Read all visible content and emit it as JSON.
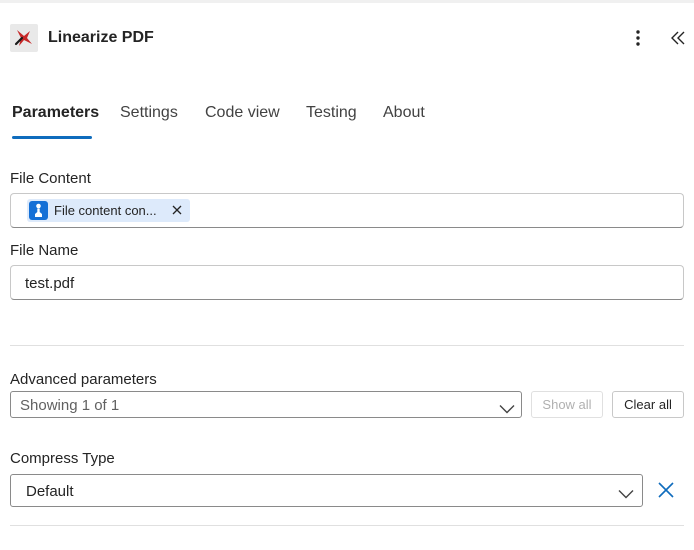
{
  "header": {
    "title": "Linearize PDF",
    "icon": "linearize-pdf-app-icon",
    "more_icon": "more-vertical-icon",
    "collapse_icon": "double-chevron-left-icon"
  },
  "tabs": [
    {
      "label": "Parameters",
      "active": true
    },
    {
      "label": "Settings",
      "active": false
    },
    {
      "label": "Code view",
      "active": false
    },
    {
      "label": "Testing",
      "active": false
    },
    {
      "label": "About",
      "active": false
    }
  ],
  "fields": {
    "file_content": {
      "label": "File Content",
      "token_label": "File content con...",
      "token_icon": "dynamic-content-icon"
    },
    "file_name": {
      "label": "File Name",
      "value": "test.pdf"
    }
  },
  "advanced": {
    "label": "Advanced parameters",
    "select_value": "Showing 1 of 1",
    "show_all": "Show all",
    "clear_all": "Clear all"
  },
  "compress": {
    "label": "Compress Type",
    "value": "Default"
  },
  "colors": {
    "accent": "#0f6cbd",
    "token_bg": "#ddeafb",
    "token_icon_bg": "#1570d6"
  }
}
